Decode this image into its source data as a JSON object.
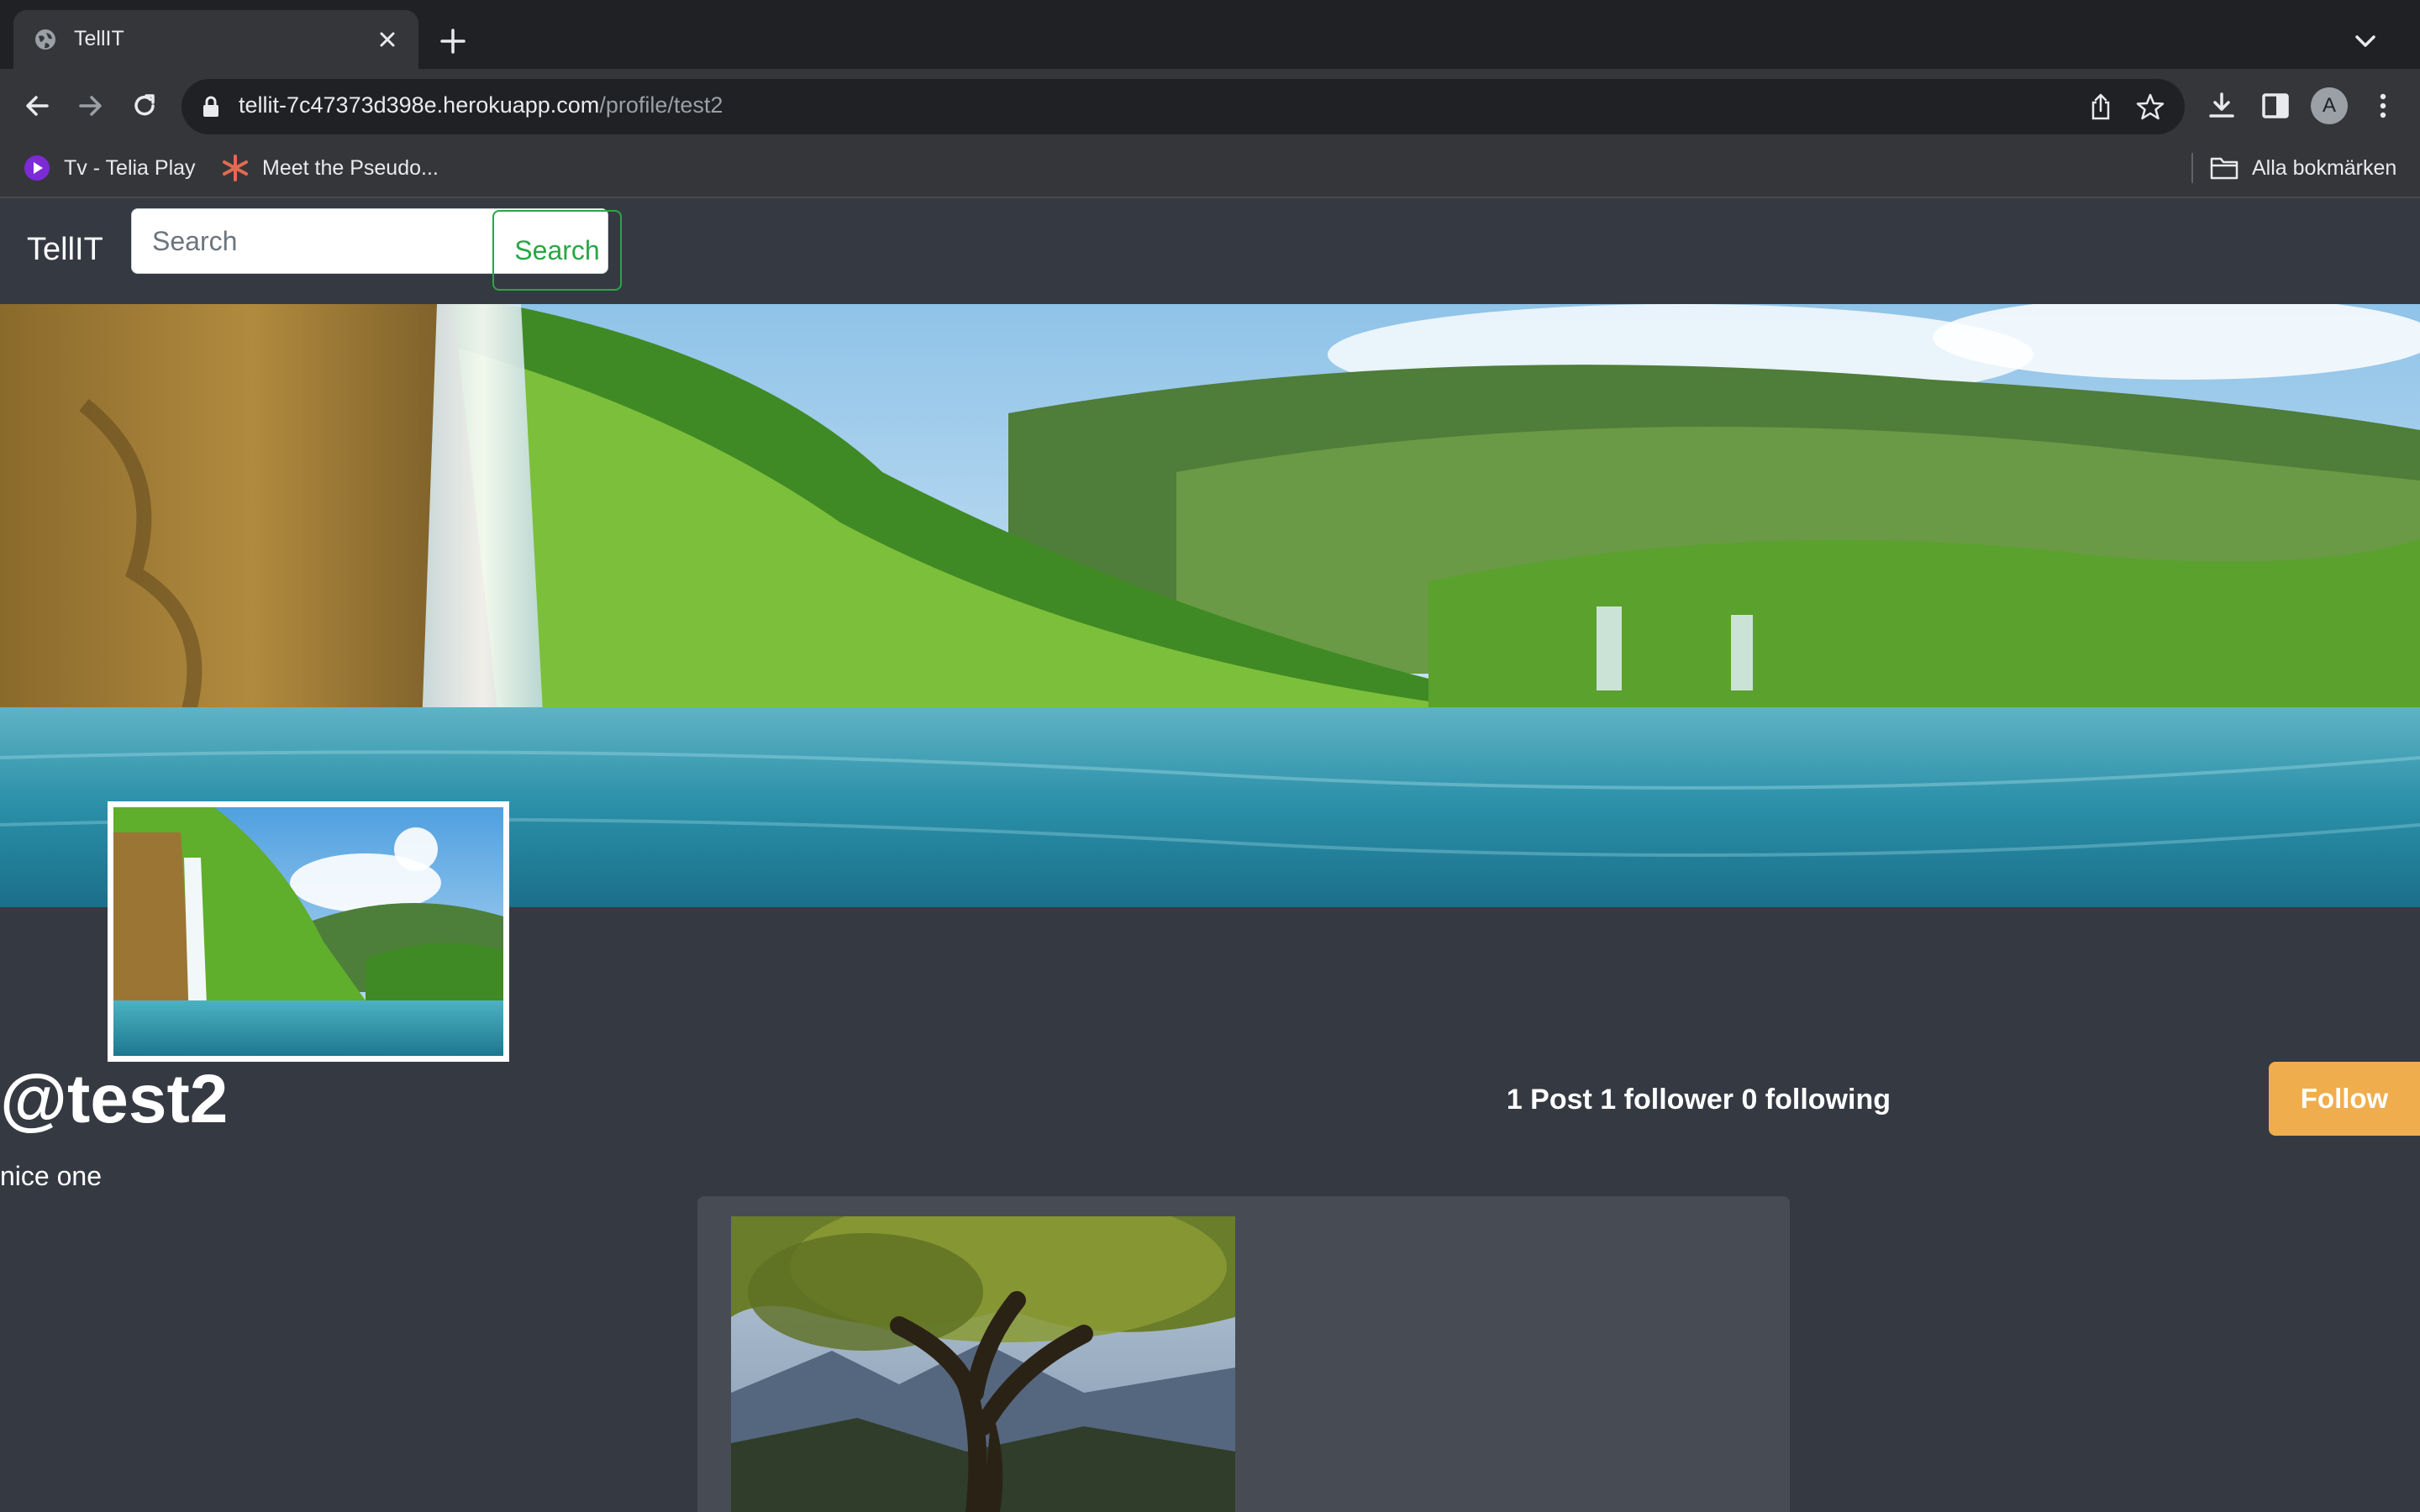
{
  "browser": {
    "tab_title": "TellIT",
    "url_host": "tellit-7c47373d398e.herokuapp.com",
    "url_path": "/profile/test2",
    "avatar_letter": "A",
    "bookmarks": [
      {
        "label": "Tv - Telia Play",
        "icon": "telia-play-icon"
      },
      {
        "label": "Meet the Pseudo...",
        "icon": "asterisk-logo-icon"
      }
    ],
    "all_bookmarks_label": "Alla bokmärken"
  },
  "navbar": {
    "brand": "TellIT",
    "search_placeholder": "Search",
    "search_button": "Search"
  },
  "profile": {
    "username": "@test2",
    "bio": "nice one",
    "stats": "1 Post 1 follower 0 following",
    "follow_button": "Follow",
    "cover_image": "waterfall-lake-landscape",
    "avatar_image": "waterfall-lake-landscape"
  },
  "post": {
    "image": "tree-mountain-landscape"
  },
  "colors": {
    "page_bg": "#353a42",
    "card_bg": "#474c54",
    "search_green": "#28a745",
    "follow_orange": "#f0ad4e"
  }
}
